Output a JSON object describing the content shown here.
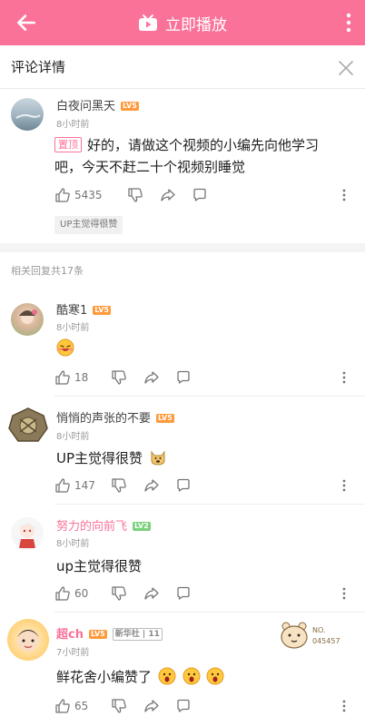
{
  "header": {
    "title": "立即播放"
  },
  "subheader": {
    "title": "评论详情"
  },
  "main_comment": {
    "username": "白夜问黑天",
    "level": "LV5",
    "time": "8小时前",
    "pin_label": "置顶",
    "text": "好的，请做这个视频的小编先向他学习吧，今天不赶二十个视频别睡觉",
    "likes": "5435",
    "tag": "UP主觉得很赞"
  },
  "replies_header": "相关回复共17条",
  "replies": [
    {
      "username": "酷寒1",
      "level": "LV5",
      "time": "8小时前",
      "text": "",
      "likes": "18"
    },
    {
      "username": "悄悄的声张的不要",
      "level": "LV5",
      "time": "8小时前",
      "text": "UP主觉得很赞",
      "likes": "147"
    },
    {
      "username": "努力的向前飞",
      "level": "LV2",
      "time": "8小时前",
      "text": "up主觉得很赞",
      "likes": "60"
    },
    {
      "username": "超ch",
      "level": "LV5",
      "badge_name": "新华社",
      "badge_level": "11",
      "time": "7小时前",
      "text": "鲜花舍小编赞了",
      "likes": "65",
      "sticker_no": "NO.",
      "sticker_id": "045457"
    }
  ],
  "colors": {
    "pink": "#fb7299",
    "lv5": "#ff9a3c",
    "lv2": "#7bd07b"
  },
  "icons": [
    "back-arrow-icon",
    "tv-play-icon",
    "more-vertical-icon",
    "close-icon",
    "like-icon",
    "dislike-icon",
    "share-icon",
    "comment-icon"
  ]
}
